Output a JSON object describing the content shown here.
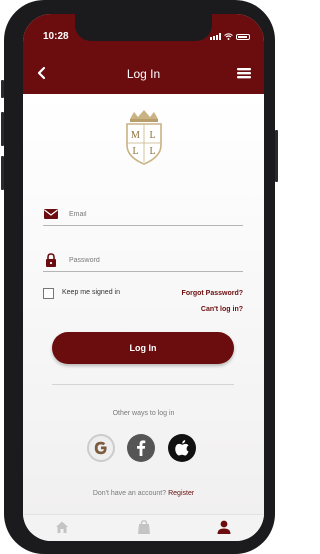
{
  "status_bar": {
    "time": "10:28"
  },
  "nav": {
    "title": "Log In",
    "back_icon": "chevron-left-icon",
    "menu_icon": "hamburger-menu-icon"
  },
  "logo": {
    "letters": [
      "M",
      "L",
      "L",
      "L"
    ]
  },
  "form": {
    "email_placeholder": "Email",
    "email_value": "",
    "password_placeholder": "Password",
    "password_value": "",
    "keep_signed_in_label": "Keep me signed in",
    "keep_signed_in_checked": false,
    "forgot_password": "Forgot Password?",
    "cant_log_in": "Can't log in?",
    "login_button": "Log In"
  },
  "social": {
    "heading": "Other ways to log in",
    "providers": [
      "google-icon",
      "facebook-icon",
      "apple-icon"
    ]
  },
  "register": {
    "prompt": "Don't have an account?",
    "link": "Register"
  },
  "tab_bar": {
    "items": [
      "home-icon",
      "bag-icon",
      "user-icon"
    ],
    "active": "user-icon"
  },
  "colors": {
    "brand": "#6b0d0f",
    "background": "#f4f3f3",
    "logo_gold": "#c9b283"
  }
}
